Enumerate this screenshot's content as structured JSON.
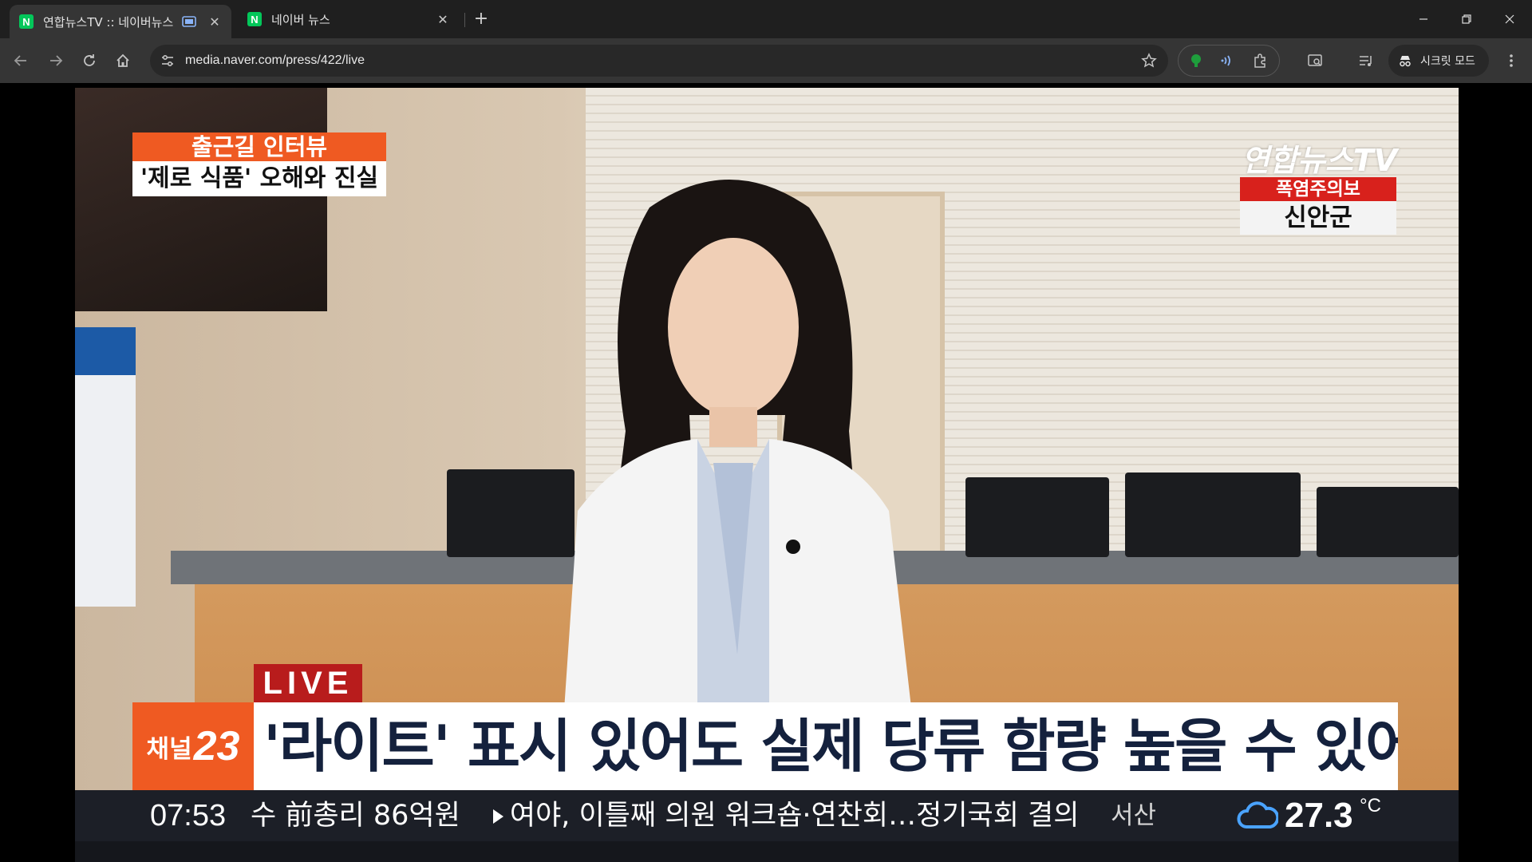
{
  "browser": {
    "tabs": [
      {
        "title": "연합뉴스TV :: 네이버뉴스",
        "favicon": "N",
        "active": true
      },
      {
        "title": "네이버 뉴스",
        "favicon": "N",
        "active": false
      }
    ],
    "address": {
      "url": "media.naver.com/press/422/live"
    },
    "incognito_label": "시크릿 모드"
  },
  "broadcast": {
    "subject": {
      "category": "출근길 인터뷰",
      "topic": "'제로 식품' 오해와 진실"
    },
    "logo": "연합뉴스TV",
    "alert": {
      "type": "폭염주의보",
      "region": "신안군"
    },
    "live_label": "LIVE",
    "channel": {
      "label": "채널",
      "number": "23"
    },
    "headline": "'라이트' 표시 있어도 실제 당류 함량 높을 수 있어",
    "ticker": {
      "time": "07:53",
      "items": [
        "수 前총리 86억원",
        "여야, 이틀째 의원 워크숍·연찬회…정기국회 결의"
      ]
    },
    "weather": {
      "city": "서산",
      "temperature": "27.3",
      "unit": "°C"
    }
  },
  "colors": {
    "accent_orange": "#ef5a22",
    "alert_red": "#d8211c",
    "live_red": "#b81c1c",
    "headline_text": "#14213d",
    "naver_green": "#03c75a"
  }
}
